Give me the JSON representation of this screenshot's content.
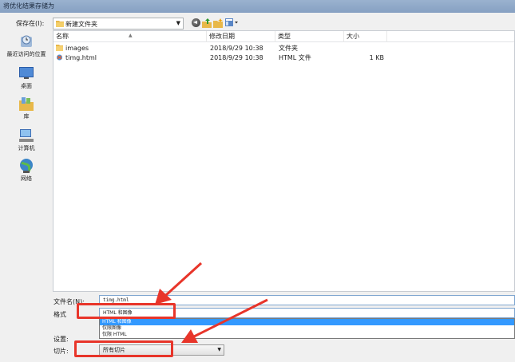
{
  "window": {
    "title": "将优化结果存储为"
  },
  "toolbar": {
    "save_in_label": "保存在(I):",
    "location": "新建文件夹"
  },
  "places": [
    {
      "label": "最近访问的位置",
      "icon": "recent-places-icon"
    },
    {
      "label": "桌面",
      "icon": "desktop-icon"
    },
    {
      "label": "库",
      "icon": "libraries-icon"
    },
    {
      "label": "计算机",
      "icon": "computer-icon"
    },
    {
      "label": "网络",
      "icon": "network-icon"
    }
  ],
  "file_list": {
    "columns": {
      "name": "名称",
      "date": "修改日期",
      "type": "类型",
      "size": "大小"
    },
    "rows": [
      {
        "name": "images",
        "date": "2018/9/29 10:38",
        "type": "文件夹",
        "size": "",
        "icon": "folder-icon"
      },
      {
        "name": "timg.html",
        "date": "2018/9/29 10:38",
        "type": "HTML 文件",
        "size": "1 KB",
        "icon": "html-file-icon"
      }
    ]
  },
  "form": {
    "filename_label": "文件名(N):",
    "filename_value": "timg.html",
    "format_label": "格式",
    "format_value": "HTML 和图像",
    "format_options": [
      "HTML 和图像",
      "仅限图像",
      "仅限 HTML"
    ],
    "settings_label": "设置:",
    "slices_label": "切片:",
    "slices_value": "所有切片"
  },
  "colors": {
    "annotation": "#e8352a",
    "selection": "#3399ff"
  }
}
